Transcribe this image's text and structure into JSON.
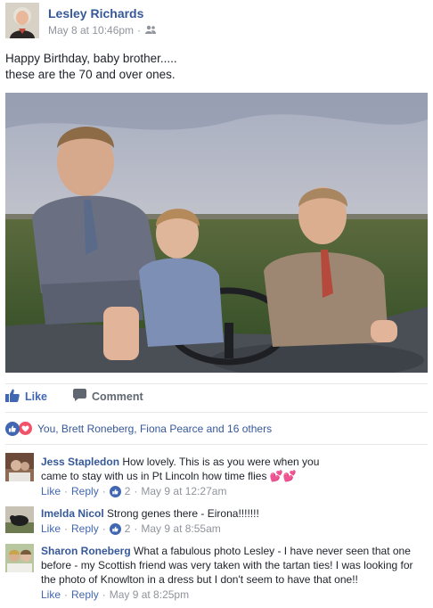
{
  "post": {
    "author": "Lesley Richards",
    "timestamp": "May 8 at 10:46pm",
    "separator": "·",
    "audience_icon": "friends-icon",
    "text": "Happy Birthday, baby brother.....\nthese are the 70 and over ones."
  },
  "actions": {
    "like_label": "Like",
    "comment_label": "Comment"
  },
  "reactions": {
    "summary": "You, Brett Roneberg, Fiona Pearce and 16 others",
    "icons": [
      "like-reaction-icon",
      "love-reaction-icon"
    ]
  },
  "comments": [
    {
      "name": "Jess Stapledon",
      "text": "How lovely. This is as you were when you came to stay with us in Pt Lincoln how time flies",
      "emoji": "💕💕",
      "like": "Like",
      "reply": "Reply",
      "likes": "2",
      "time": "May 9 at 12:27am"
    },
    {
      "name": "Imelda Nicol",
      "text": "Strong genes there - Eirona!!!!!!!",
      "like": "Like",
      "reply": "Reply",
      "likes": "2",
      "time": "May 9 at 8:55am"
    },
    {
      "name": "Sharon Roneberg",
      "text": "What a fabulous photo Lesley - I have never seen that one before - my Scottish friend was very taken with the tartan ties! I was looking for the photo of Knowlton in a dress but I don't seem to have that one!!",
      "like": "Like",
      "reply": "Reply",
      "time": "May 9 at 8:25pm"
    }
  ],
  "colors": {
    "link_blue": "#365899",
    "action_blue": "#4267b2",
    "meta_gray": "#90949c",
    "love_red": "#f25268"
  }
}
